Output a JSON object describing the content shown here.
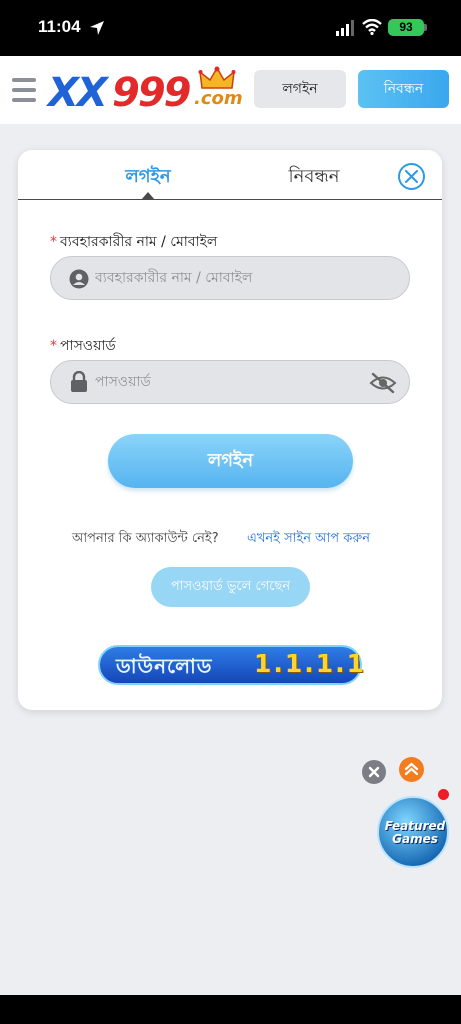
{
  "status_bar": {
    "time": "11:04",
    "battery": "93"
  },
  "header": {
    "logo": {
      "part1": "XX",
      "part2": "999",
      "suffix": ".com"
    },
    "login_label": "লগইন",
    "register_label": "নিবন্ধন"
  },
  "tabs": {
    "login": "লগইন",
    "register": "নিবন্ধন"
  },
  "form": {
    "username": {
      "label": "ব্যবহারকারীর নাম / মোবাইল",
      "placeholder": "ব্যবহারকারীর নাম / মোবাইল",
      "value": ""
    },
    "password": {
      "label": "পাসওয়ার্ড",
      "placeholder": "পাসওয়ার্ড",
      "value": ""
    },
    "required_mark": "*",
    "login_button": "লগইন",
    "no_account_text": "আপনার কি অ্যাকাউন্ট নেই?",
    "signup_link": "এখনই সাইন আপ করুন",
    "forgot_button": "পাসওয়ার্ড ভুলে গেছেন",
    "download_label": "ডাউনলোড",
    "download_version": "1.1.1.1"
  },
  "floating": {
    "featured_top": "Featured",
    "featured_bottom": "Games"
  },
  "colors": {
    "accent": "#2e9ae6",
    "link": "#1f6ed9",
    "required": "#e53935",
    "logo_blue": "#1f63d6",
    "logo_red": "#e22a2a"
  },
  "icons": [
    "location-arrow-icon",
    "signal-icon",
    "wifi-icon",
    "battery-icon",
    "menu-icon",
    "crown-icon",
    "close-icon",
    "user-icon",
    "lock-icon",
    "eye-off-icon",
    "chevron-up-icon"
  ]
}
